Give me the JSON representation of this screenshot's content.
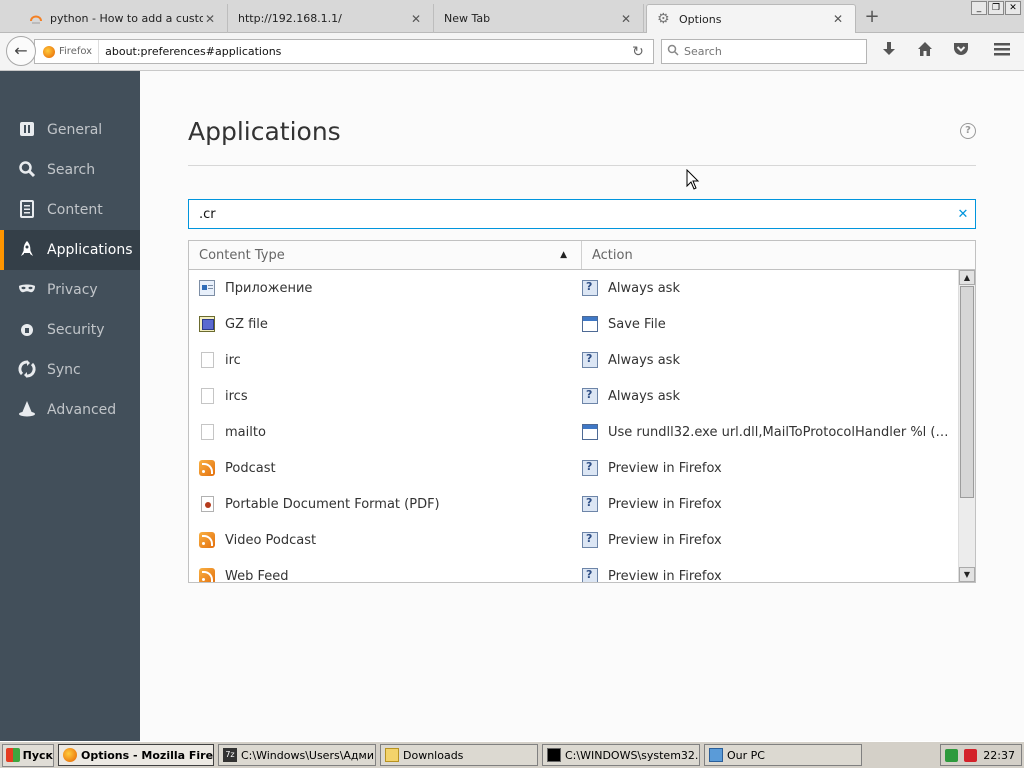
{
  "tabs": [
    {
      "title": "python - How to add a custo...",
      "icon": "python-icon",
      "active": false
    },
    {
      "title": "http://192.168.1.1/",
      "icon": "",
      "active": false
    },
    {
      "title": "New Tab",
      "icon": "",
      "active": false
    },
    {
      "title": "Options",
      "icon": "gear-icon",
      "active": true
    }
  ],
  "window_controls": {
    "minimize": "_",
    "maximize": "❐",
    "close": "✕"
  },
  "navbar": {
    "identity": "Firefox",
    "url": "about:preferences#applications",
    "search_placeholder": "Search"
  },
  "sidebar": {
    "items": [
      {
        "label": "General",
        "icon": "general-icon"
      },
      {
        "label": "Search",
        "icon": "search-icon"
      },
      {
        "label": "Content",
        "icon": "content-icon"
      },
      {
        "label": "Applications",
        "icon": "applications-icon",
        "active": true
      },
      {
        "label": "Privacy",
        "icon": "privacy-mask-icon"
      },
      {
        "label": "Security",
        "icon": "security-lock-icon"
      },
      {
        "label": "Sync",
        "icon": "sync-icon"
      },
      {
        "label": "Advanced",
        "icon": "advanced-wizard-icon"
      }
    ]
  },
  "main": {
    "title": "Applications",
    "help": "?",
    "filter_value": ".cr",
    "columns": {
      "type": "Content Type",
      "action": "Action"
    },
    "rows": [
      {
        "type": "Приложение",
        "type_icon": "app",
        "action": "Always ask",
        "action_icon": "ask"
      },
      {
        "type": "GZ file",
        "type_icon": "gz",
        "action": "Save File",
        "action_icon": "save"
      },
      {
        "type": "irc",
        "type_icon": "blank",
        "action": "Always ask",
        "action_icon": "ask"
      },
      {
        "type": "ircs",
        "type_icon": "blank",
        "action": "Always ask",
        "action_icon": "ask"
      },
      {
        "type": "mailto",
        "type_icon": "blank",
        "action": "Use rundll32.exe url.dll,MailToProtocolHandler %l (defa...",
        "action_icon": "save"
      },
      {
        "type": "Podcast",
        "type_icon": "rss",
        "action": "Preview in Firefox",
        "action_icon": "ask"
      },
      {
        "type": "Portable Document Format (PDF)",
        "type_icon": "pdf",
        "action": "Preview in Firefox",
        "action_icon": "ask"
      },
      {
        "type": "Video Podcast",
        "type_icon": "rss",
        "action": "Preview in Firefox",
        "action_icon": "ask"
      },
      {
        "type": "Web Feed",
        "type_icon": "rss",
        "action": "Preview in Firefox",
        "action_icon": "ask"
      }
    ]
  },
  "taskbar": {
    "start": "Пуск",
    "tasks": [
      {
        "label": "Options - Mozilla Firef...",
        "icon": "fx",
        "active": true
      },
      {
        "label": "C:\\Windows\\Users\\Адми...",
        "icon": "7z",
        "icon_text": "7z",
        "active": false
      },
      {
        "label": "Downloads",
        "icon": "folder",
        "active": false
      },
      {
        "label": "C:\\WINDOWS\\system32...",
        "icon": "cmd",
        "active": false
      },
      {
        "label": "Our PC",
        "icon": "pc",
        "active": false
      }
    ],
    "clock": "22:37"
  },
  "colors": {
    "accent": "#0095dd",
    "sidebar_bg": "#424f5a",
    "active_marker": "#ff9500"
  }
}
